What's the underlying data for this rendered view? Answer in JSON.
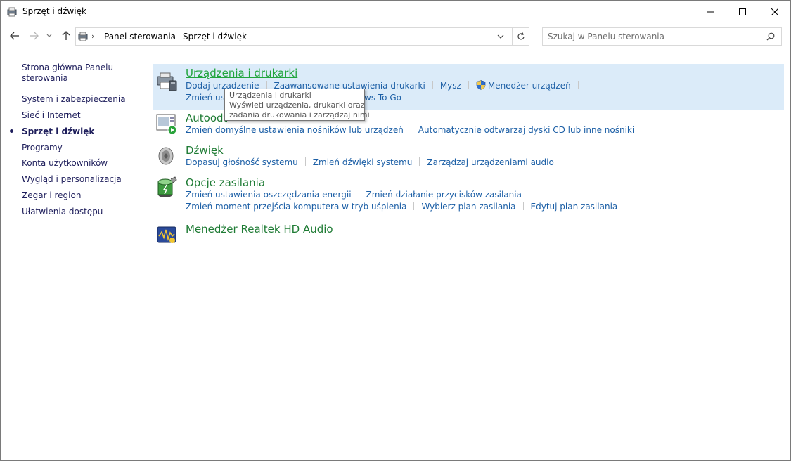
{
  "window": {
    "title": "Sprzęt i dźwięk",
    "icon": "control-panel-icon",
    "buttons": {
      "minimize": "minimize-icon",
      "maximize": "maximize-icon",
      "close": "close-icon"
    }
  },
  "address_bar": {
    "crumbs": [
      "Panel sterowania",
      "Sprzęt i dźwięk"
    ],
    "separator": "›"
  },
  "search": {
    "placeholder": "Szukaj w Panelu sterowania"
  },
  "sidebar": {
    "home_label": "Strona główna Panelu sterowania",
    "items": [
      {
        "label": "System i zabezpieczenia",
        "active": false
      },
      {
        "label": "Sieć i Internet",
        "active": false
      },
      {
        "label": "Sprzęt i dźwięk",
        "active": true
      },
      {
        "label": "Programy",
        "active": false
      },
      {
        "label": "Konta użytkowników",
        "active": false
      },
      {
        "label": "Wygląd i personalizacja",
        "active": false
      },
      {
        "label": "Zegar i region",
        "active": false
      },
      {
        "label": "Ułatwienia dostępu",
        "active": false
      }
    ]
  },
  "categories": {
    "devices": {
      "title": "Urządzenia i drukarki",
      "icon": "printer-icon",
      "links_row1": [
        "Dodaj urządzenie",
        "Zaawansowane ustawienia drukarki",
        "Mysz",
        "Menedżer urządzeń"
      ],
      "links_row2_visible": [
        "Zmień usta",
        "ws To Go"
      ]
    },
    "autoplay": {
      "title_visible": "Autoodt",
      "icon": "autoplay-icon",
      "links": [
        "Zmień domyślne ustawienia nośników lub urządzeń",
        "Automatycznie odtwarzaj dyski CD lub inne nośniki"
      ]
    },
    "sound": {
      "title": "Dźwięk",
      "icon": "speaker-icon",
      "links": [
        "Dopasuj głośność systemu",
        "Zmień dźwięki systemu",
        "Zarządzaj urządzeniami audio"
      ]
    },
    "power": {
      "title": "Opcje zasilania",
      "icon": "battery-icon",
      "links_row1": [
        "Zmień ustawienia oszczędzania energii",
        "Zmień działanie przycisków zasilania"
      ],
      "links_row2": [
        "Zmień moment przejścia komputera w tryb uśpienia",
        "Wybierz plan zasilania",
        "Edytuj plan zasilania"
      ]
    },
    "realtek": {
      "title": "Menedżer Realtek HD Audio",
      "icon": "realtek-audio-icon"
    }
  },
  "tooltip": {
    "title": "Urządzenia i drukarki",
    "line1": "Wyświetl urządzenia, drukarki oraz",
    "line2": "zadania drukowania i zarządzaj nimi"
  },
  "colors": {
    "category_title": "#1e7b34",
    "link": "#1c5fa6",
    "hover_bg": "#dbebf9",
    "sidebar_link": "#1f1f5c"
  }
}
